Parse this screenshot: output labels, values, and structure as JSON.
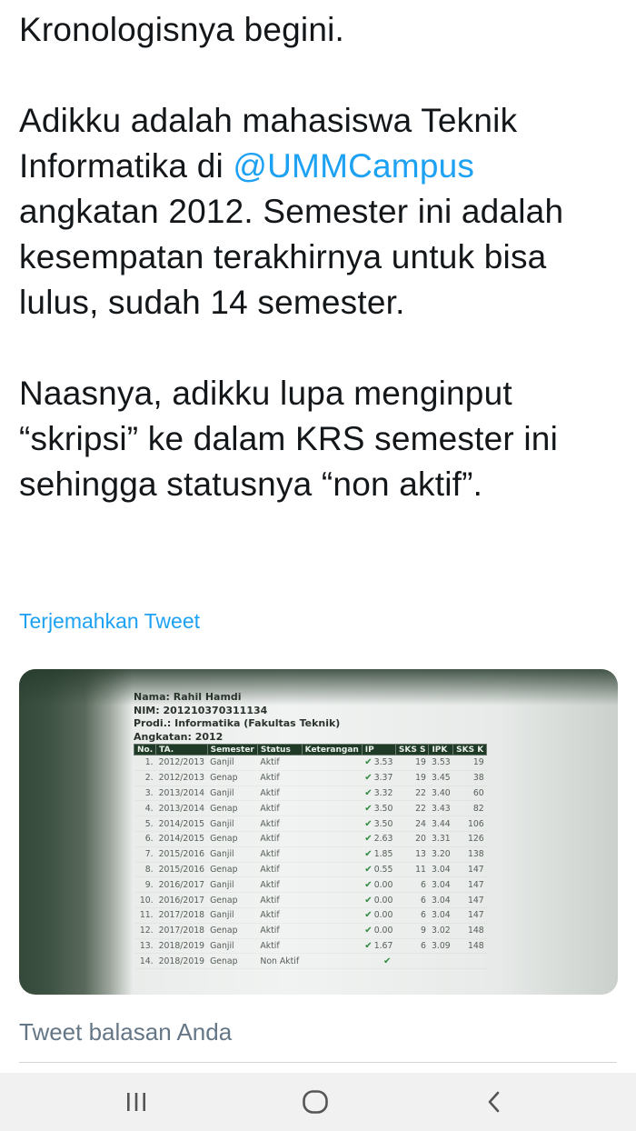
{
  "tweet": {
    "paragraph1": "Kronologisnya begini.",
    "paragraph2_before": "Adikku adalah mahasiswa Teknik Informatika di ",
    "mention": "@UMMCampus",
    "paragraph2_after": " angkatan 2012. Semester ini adalah kesempatan terakhirnya untuk bisa lulus, sudah 14 semester.",
    "paragraph3": "Naasnya, adikku lupa menginput “skripsi” ke dalam KRS semester ini sehingga statusnya “non aktif”.",
    "translate_link": "Terjemahkan Tweet"
  },
  "photo": {
    "name": "Nama: Rahil Hamdi",
    "nim": "NIM: 201210370311134",
    "prodi": "Prodi.: Informatika (Fakultas Teknik)",
    "angkatan": "Angkatan: 2012",
    "columns": [
      "No.",
      "TA.",
      "Semester",
      "Status",
      "Keterangan",
      "IP",
      "SKS S",
      "IPK",
      "SKS K"
    ],
    "rows": [
      {
        "no": "1.",
        "ta": "2012/2013",
        "sem": "Ganjil",
        "status": "Aktif",
        "ip": "3.53",
        "sks": "19",
        "ipk": "3.53",
        "sksk": "19"
      },
      {
        "no": "2.",
        "ta": "2012/2013",
        "sem": "Genap",
        "status": "Aktif",
        "ip": "3.37",
        "sks": "19",
        "ipk": "3.45",
        "sksk": "38"
      },
      {
        "no": "3.",
        "ta": "2013/2014",
        "sem": "Ganjil",
        "status": "Aktif",
        "ip": "3.32",
        "sks": "22",
        "ipk": "3.40",
        "sksk": "60"
      },
      {
        "no": "4.",
        "ta": "2013/2014",
        "sem": "Genap",
        "status": "Aktif",
        "ip": "3.50",
        "sks": "22",
        "ipk": "3.43",
        "sksk": "82"
      },
      {
        "no": "5.",
        "ta": "2014/2015",
        "sem": "Ganjil",
        "status": "Aktif",
        "ip": "3.50",
        "sks": "24",
        "ipk": "3.44",
        "sksk": "106"
      },
      {
        "no": "6.",
        "ta": "2014/2015",
        "sem": "Genap",
        "status": "Aktif",
        "ip": "2.63",
        "sks": "20",
        "ipk": "3.31",
        "sksk": "126"
      },
      {
        "no": "7.",
        "ta": "2015/2016",
        "sem": "Ganjil",
        "status": "Aktif",
        "ip": "1.85",
        "sks": "13",
        "ipk": "3.20",
        "sksk": "138"
      },
      {
        "no": "8.",
        "ta": "2015/2016",
        "sem": "Genap",
        "status": "Aktif",
        "ip": "0.55",
        "sks": "11",
        "ipk": "3.04",
        "sksk": "147"
      },
      {
        "no": "9.",
        "ta": "2016/2017",
        "sem": "Ganjil",
        "status": "Aktif",
        "ip": "0.00",
        "sks": "6",
        "ipk": "3.04",
        "sksk": "147"
      },
      {
        "no": "10.",
        "ta": "2016/2017",
        "sem": "Genap",
        "status": "Aktif",
        "ip": "0.00",
        "sks": "6",
        "ipk": "3.04",
        "sksk": "147"
      },
      {
        "no": "11.",
        "ta": "2017/2018",
        "sem": "Ganjil",
        "status": "Aktif",
        "ip": "0.00",
        "sks": "6",
        "ipk": "3.04",
        "sksk": "147"
      },
      {
        "no": "12.",
        "ta": "2017/2018",
        "sem": "Genap",
        "status": "Aktif",
        "ip": "0.00",
        "sks": "9",
        "ipk": "3.02",
        "sksk": "148"
      },
      {
        "no": "13.",
        "ta": "2018/2019",
        "sem": "Ganjil",
        "status": "Aktif",
        "ip": "1.67",
        "sks": "6",
        "ipk": "3.09",
        "sksk": "148"
      },
      {
        "no": "14.",
        "ta": "2018/2019",
        "sem": "Genap",
        "status": "Non Aktif",
        "ip": "",
        "sks": "",
        "ipk": "",
        "sksk": ""
      }
    ]
  },
  "reply": {
    "placeholder": "Tweet balasan Anda"
  },
  "navbar": {
    "recents_icon": "recent-apps-icon",
    "home_icon": "home-icon",
    "back_icon": "back-icon"
  },
  "colors": {
    "link": "#1da1f2",
    "text": "#14171a",
    "muted": "#657786"
  }
}
